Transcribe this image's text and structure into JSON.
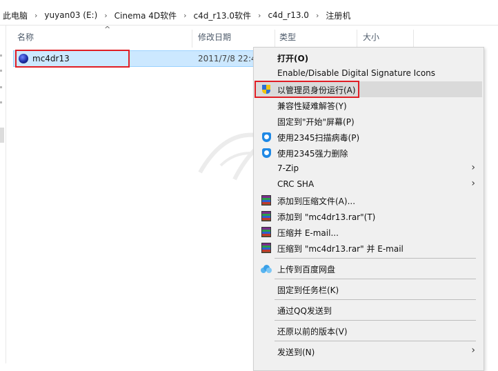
{
  "breadcrumb": {
    "items": [
      "此电脑",
      "yuyan03 (E:)",
      "Cinema 4D软件",
      "c4d_r13.0软件",
      "c4d_r13.0",
      "注册机"
    ],
    "separator": "›"
  },
  "columns": {
    "name": "名称",
    "date": "修改日期",
    "type": "类型",
    "size": "大小"
  },
  "file": {
    "name": "mc4dr13",
    "date": "2011/7/8 22:4"
  },
  "context_menu": {
    "items": [
      {
        "label": "打开(O)",
        "bold": true,
        "icon": "none"
      },
      {
        "label": "Enable/Disable Digital Signature Icons",
        "icon": "none"
      },
      {
        "label": "以管理员身份运行(A)",
        "icon": "uac-shield-icon",
        "highlighted": true
      },
      {
        "label": "兼容性疑难解答(Y)",
        "icon": "none"
      },
      {
        "label": "固定到\"开始\"屏幕(P)",
        "icon": "none"
      },
      {
        "label": "使用2345扫描病毒(P)",
        "icon": "2345-shield-icon"
      },
      {
        "label": "使用2345强力删除",
        "icon": "2345-shield-icon"
      },
      {
        "label": "7-Zip",
        "icon": "none",
        "submenu": true
      },
      {
        "label": "CRC SHA",
        "icon": "none",
        "submenu": true
      },
      {
        "label": "添加到压缩文件(A)...",
        "icon": "winrar-icon"
      },
      {
        "label": "添加到 \"mc4dr13.rar\"(T)",
        "icon": "winrar-icon"
      },
      {
        "label": "压缩并 E-mail...",
        "icon": "winrar-icon"
      },
      {
        "label": "压缩到 \"mc4dr13.rar\" 并 E-mail",
        "icon": "winrar-icon"
      },
      {
        "label": "上传到百度网盘",
        "icon": "baidu-cloud-icon"
      },
      {
        "label": "固定到任务栏(K)",
        "icon": "none"
      },
      {
        "label": "通过QQ发送到",
        "icon": "none"
      },
      {
        "label": "还原以前的版本(V)",
        "icon": "none"
      },
      {
        "label": "发送到(N)",
        "icon": "none",
        "submenu": true
      }
    ]
  },
  "colors": {
    "selection_bg": "#cce8ff",
    "highlight_border": "#e01d24",
    "menu_bg": "#f0f0f0"
  }
}
